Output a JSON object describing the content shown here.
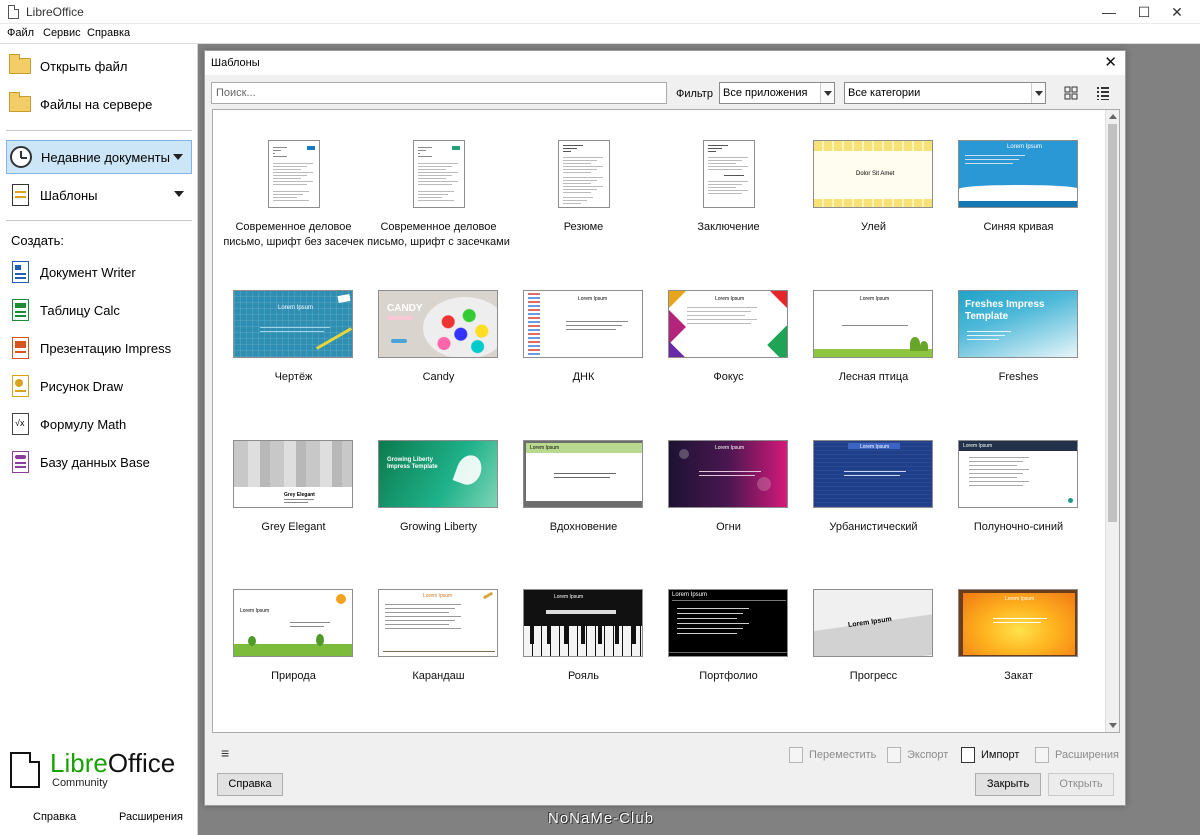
{
  "window": {
    "title": "LibreOffice"
  },
  "menu": {
    "file": "Файл",
    "tools": "Сервис",
    "help": "Справка"
  },
  "sidebar": {
    "open_file": "Открыть файл",
    "remote_files": "Файлы на сервере",
    "recent_docs": "Недавние документы",
    "templates": "Шаблоны",
    "create_heading": "Создать:",
    "create": [
      {
        "label": "Документ Writer",
        "color": "#1f5fb4"
      },
      {
        "label": "Таблицу Calc",
        "color": "#1e8c35"
      },
      {
        "label": "Презентацию Impress",
        "color": "#d5541f"
      },
      {
        "label": "Рисунок Draw",
        "color": "#d9a21b"
      },
      {
        "label": "Формулу Math",
        "color": "#555555"
      },
      {
        "label": "Базу данных Base",
        "color": "#8a3f9e"
      }
    ],
    "logo_lib": "Libre",
    "logo_office": "Office",
    "logo_community": "Community",
    "footer_help": "Справка",
    "footer_extensions": "Расширения"
  },
  "dialog": {
    "title": "Шаблоны",
    "search_placeholder": "Поиск...",
    "filter_label": "Фильтр",
    "filter_app": "Все приложения",
    "filter_category": "Все категории",
    "actions": {
      "move": "Переместить",
      "export": "Экспорт",
      "import": "Импорт",
      "extensions": "Расширения"
    },
    "help_button": "Справка",
    "close_button": "Закрыть",
    "open_button": "Открыть"
  },
  "templates": [
    {
      "name": "Современное деловое письмо, шрифт без засечек",
      "kind": "letter"
    },
    {
      "name": "Современное деловое письмо, шрифт с засечками",
      "kind": "letter2"
    },
    {
      "name": "Резюме",
      "kind": "resume"
    },
    {
      "name": "Заключение",
      "kind": "resume2"
    },
    {
      "name": "Улей",
      "kind": "hive",
      "text": "Dolor Sit Amet"
    },
    {
      "name": "Синяя кривая",
      "kind": "bluecurve",
      "text": "Lorem Ipsum"
    },
    {
      "name": "Чертёж",
      "kind": "blueprint",
      "text": "Lorem Ipsum"
    },
    {
      "name": "Candy",
      "kind": "candy",
      "text": "CANDY"
    },
    {
      "name": "ДНК",
      "kind": "dna",
      "text": "Lorem Ipsum"
    },
    {
      "name": "Фокус",
      "kind": "focus",
      "text": "Lorem Ipsum"
    },
    {
      "name": "Лесная птица",
      "kind": "forest",
      "text": "Lorem Ipsum"
    },
    {
      "name": "Freshes",
      "kind": "freshes",
      "text": "Freshes Impress Template"
    },
    {
      "name": "Grey Elegant",
      "kind": "grey",
      "text": "Grey Elegant"
    },
    {
      "name": "Growing Liberty",
      "kind": "growing",
      "text": "Growing Liberty Impress Template"
    },
    {
      "name": "Вдохновение",
      "kind": "inspire",
      "text": "Lorem Ipsum"
    },
    {
      "name": "Огни",
      "kind": "lights",
      "text": "Lorem Ipsum"
    },
    {
      "name": "Урбанистический",
      "kind": "urban",
      "text": "Lorem Ipsum"
    },
    {
      "name": "Полуночно-синий",
      "kind": "midnight",
      "text": "Lorem Ipsum"
    },
    {
      "name": "Природа",
      "kind": "nature",
      "text": "Lorem Ipsum"
    },
    {
      "name": "Карандаш",
      "kind": "pencil",
      "text": "Lorem Ipsum"
    },
    {
      "name": "Рояль",
      "kind": "piano",
      "text": "Lorem Ipsum"
    },
    {
      "name": "Портфолио",
      "kind": "portfolio",
      "text": "Lorem Ipsum"
    },
    {
      "name": "Прогресс",
      "kind": "progress",
      "text": "Lorem Ipsum"
    },
    {
      "name": "Закат",
      "kind": "sunset",
      "text": "Lorem Ipsum"
    }
  ],
  "watermark": "NoNaMe-Club"
}
